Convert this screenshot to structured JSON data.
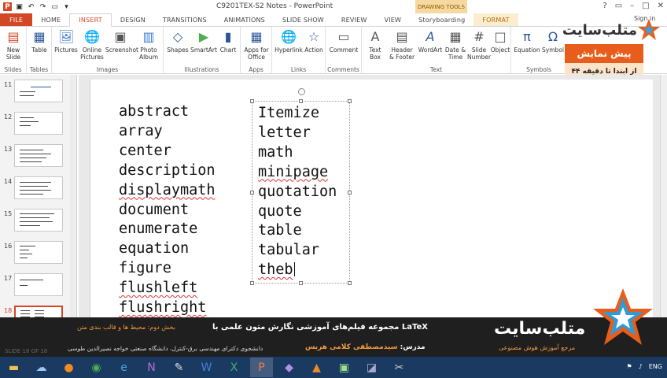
{
  "window": {
    "title": "C9201TEX-S2 Notes - PowerPoint",
    "drawing_tools": "DRAWING TOOLS",
    "signin": "Sign in"
  },
  "tabs": [
    {
      "label": "FILE"
    },
    {
      "label": "HOME"
    },
    {
      "label": "INSERT"
    },
    {
      "label": "DESIGN"
    },
    {
      "label": "TRANSITIONS"
    },
    {
      "label": "ANIMATIONS"
    },
    {
      "label": "SLIDE SHOW"
    },
    {
      "label": "REVIEW"
    },
    {
      "label": "VIEW"
    },
    {
      "label": "Storyboarding"
    },
    {
      "label": "FORMAT"
    }
  ],
  "ribbon": {
    "new_slide": "New\nSlide",
    "table": "Table",
    "pictures": "Pictures",
    "online_pictures": "Online\nPictures",
    "screenshot": "Screenshot",
    "photo_album": "Photo\nAlbum",
    "shapes": "Shapes",
    "smartart": "SmartArt",
    "chart": "Chart",
    "apps_for_office": "Apps for\nOffice",
    "hyperlink": "Hyperlink",
    "action": "Action",
    "comment": "Comment",
    "text_box": "Text\nBox",
    "header_footer": "Header\n& Footer",
    "wordart": "WordArt",
    "date_time": "Date &\nTime",
    "slide_number": "Slide\nNumber",
    "object": "Object",
    "equation": "Equation",
    "symbol": "Symbol",
    "groups": {
      "slides": "Slides",
      "tables": "Tables",
      "images": "Images",
      "illustrations": "Illustrations",
      "apps": "Apps",
      "links": "Links",
      "comments": "Comments",
      "text": "Text",
      "symbols": "Symbols"
    }
  },
  "overlay": {
    "logo": "متلب‌سایت",
    "preview_title": "پیش نمایش",
    "preview_sub": "از ابتدا تا دقیقه ۴۴"
  },
  "thumbnails": [
    {
      "num": "11"
    },
    {
      "num": "12"
    },
    {
      "num": "13"
    },
    {
      "num": "14"
    },
    {
      "num": "15"
    },
    {
      "num": "16"
    },
    {
      "num": "17"
    },
    {
      "num": "18"
    }
  ],
  "slide": {
    "left_column": [
      {
        "text": "abstract",
        "spell": false
      },
      {
        "text": "array",
        "spell": false
      },
      {
        "text": "center",
        "spell": false
      },
      {
        "text": "description",
        "spell": false
      },
      {
        "text": "displaymath",
        "spell": true
      },
      {
        "text": "document",
        "spell": false
      },
      {
        "text": "enumerate",
        "spell": false
      },
      {
        "text": "equation",
        "spell": false
      },
      {
        "text": "figure",
        "spell": false
      },
      {
        "text": "flushleft",
        "spell": true
      },
      {
        "text": "flushright",
        "spell": true
      }
    ],
    "right_column": [
      {
        "text": "Itemize",
        "spell": false
      },
      {
        "text": "letter",
        "spell": false
      },
      {
        "text": "math",
        "spell": false
      },
      {
        "text": "minipage",
        "spell": true
      },
      {
        "text": "quotation",
        "spell": false
      },
      {
        "text": "quote",
        "spell": false
      },
      {
        "text": "table",
        "spell": false
      },
      {
        "text": "tabular",
        "spell": false
      },
      {
        "text": "theb",
        "spell": true
      }
    ]
  },
  "banner": {
    "title": "مجموعه فیلم‌های آموزشی نگارش متون علمی با LaTeX",
    "subtitle": "بخش دوم: محیط ها و قالب بندی متن",
    "brand": "متلب‌سایت",
    "teacher_label": "مدرس:",
    "teacher_name": "سیدمصطفی کلامی هریس",
    "university": "دانشجوی دکترای مهندسی برق-کنترل، دانشگاه صنعتی خواجه نصیرالدین طوسی",
    "reference": "مرجع آموزش هوش مصنوعی",
    "status_slide": "SLIDE 18 OF 18"
  },
  "taskbar": {
    "language": "ENG"
  }
}
